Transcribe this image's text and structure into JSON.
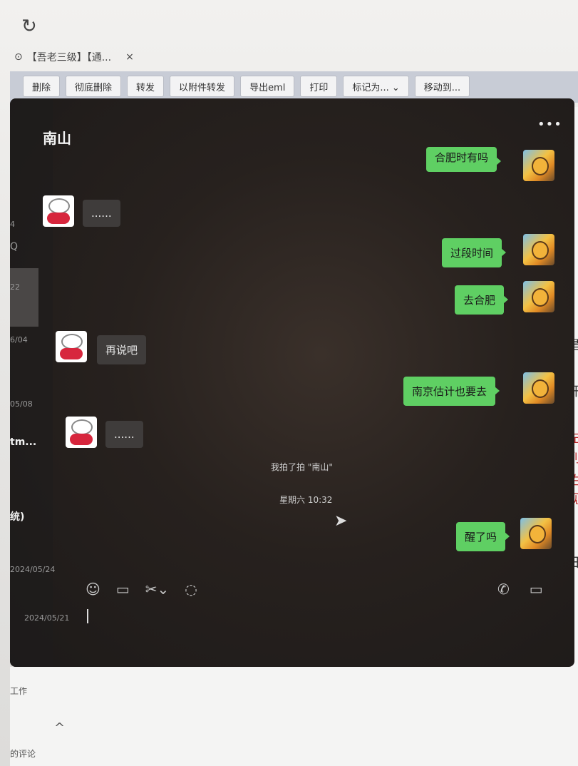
{
  "browser": {
    "reload_icon": "↻",
    "tab_title": "【吾老三级】【通...",
    "tab_close": "×"
  },
  "toolbar": {
    "buttons": [
      "删除",
      "彻底删除",
      "转发",
      "以附件转发",
      "导出eml",
      "打印",
      "标记为...  ⌄",
      "移动到..."
    ]
  },
  "chat": {
    "title": "南山",
    "more": "•••",
    "sidebar": {
      "items": [
        "4",
        "Q",
        "22",
        "6/04",
        "05/08",
        "2024/05/24",
        "2024/05/21"
      ],
      "bold_items": [
        "tm...",
        "统)"
      ]
    },
    "messages_left": [
      "......",
      "再说吧",
      "......"
    ],
    "messages_right": [
      "合肥时有吗",
      "过段时间",
      "去合肥",
      "南京估计也要去",
      "醒了吗"
    ],
    "system": {
      "pat": "我拍了拍 \"南山\"",
      "time": "星期六 10:32"
    },
    "toolbar_icons": [
      "emoji-icon",
      "folder-icon",
      "scissors-icon",
      "chat-history-icon"
    ],
    "toolbar_icons_right": [
      "phone-icon",
      "video-icon"
    ]
  },
  "bottom": {
    "left_text_1": "工作",
    "left_text_2": "的评论",
    "chevron": "^"
  },
  "right_edge": {
    "chars": [
      "是",
      "开",
      "左",
      "列",
      "佑",
      "视",
      "日"
    ]
  }
}
